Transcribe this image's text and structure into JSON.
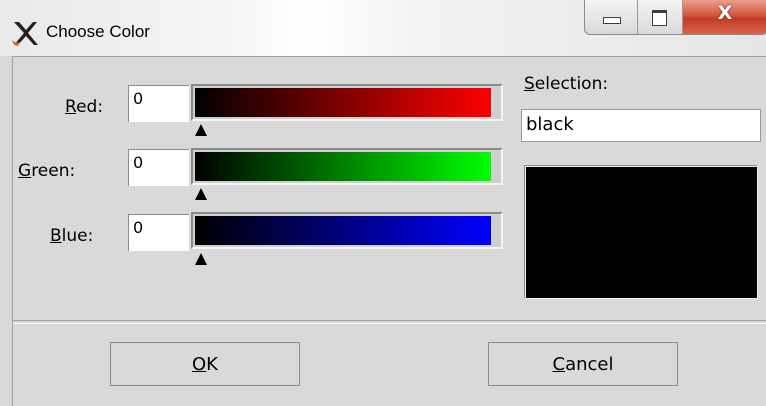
{
  "window": {
    "title": "Choose Color",
    "icon": "x-logo-icon",
    "controls": {
      "minimize": "minimize-icon",
      "maximize": "maximize-icon",
      "close": "X"
    }
  },
  "channels": [
    {
      "label_key": "R",
      "label_rest": "ed:",
      "value": "0",
      "color": "#ff0000"
    },
    {
      "label_key": "G",
      "label_rest": "reen:",
      "value": "0",
      "color": "#00ff00"
    },
    {
      "label_key": "B",
      "label_rest": "lue:",
      "value": "0",
      "color": "#0000ff"
    }
  ],
  "selection": {
    "label_key": "S",
    "label_rest": "election:",
    "value": "black",
    "swatch_color": "#000000"
  },
  "buttons": {
    "ok_key": "O",
    "ok_rest": "K",
    "cancel_key": "C",
    "cancel_rest": "ancel"
  }
}
